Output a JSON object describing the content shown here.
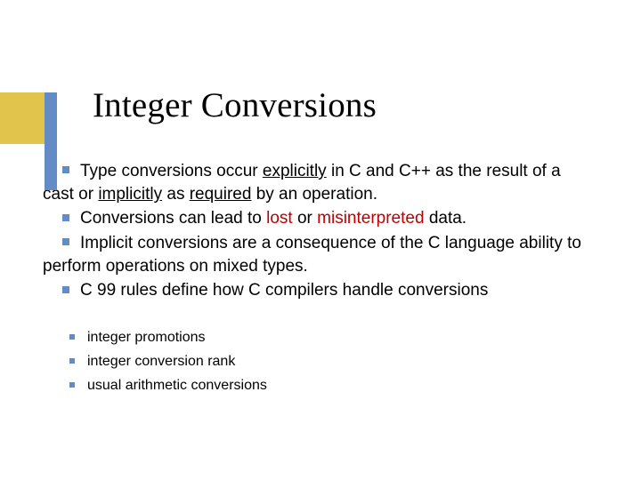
{
  "title": "Integer Conversions",
  "body": {
    "p1a": "Type conversions occur ",
    "p1b": "explicitly",
    "p1c": " in C and C++ as the result of a cast or ",
    "p1d": "implicitly",
    "p1e": " as ",
    "p1f": "required",
    "p1g": " by an operation.",
    "p2a": "Conversions can lead to ",
    "p2b": "lost",
    "p2c": " or ",
    "p2d": "misinterpreted",
    "p2e": " data.",
    "p3": "Implicit conversions are a consequence of the C language ability to perform operations on mixed types.",
    "p4": "C 99 rules define how C compilers handle conversions"
  },
  "sub": {
    "s1": "integer promotions",
    "s2": "integer conversion rank",
    "s3": "usual arithmetic conversions"
  }
}
